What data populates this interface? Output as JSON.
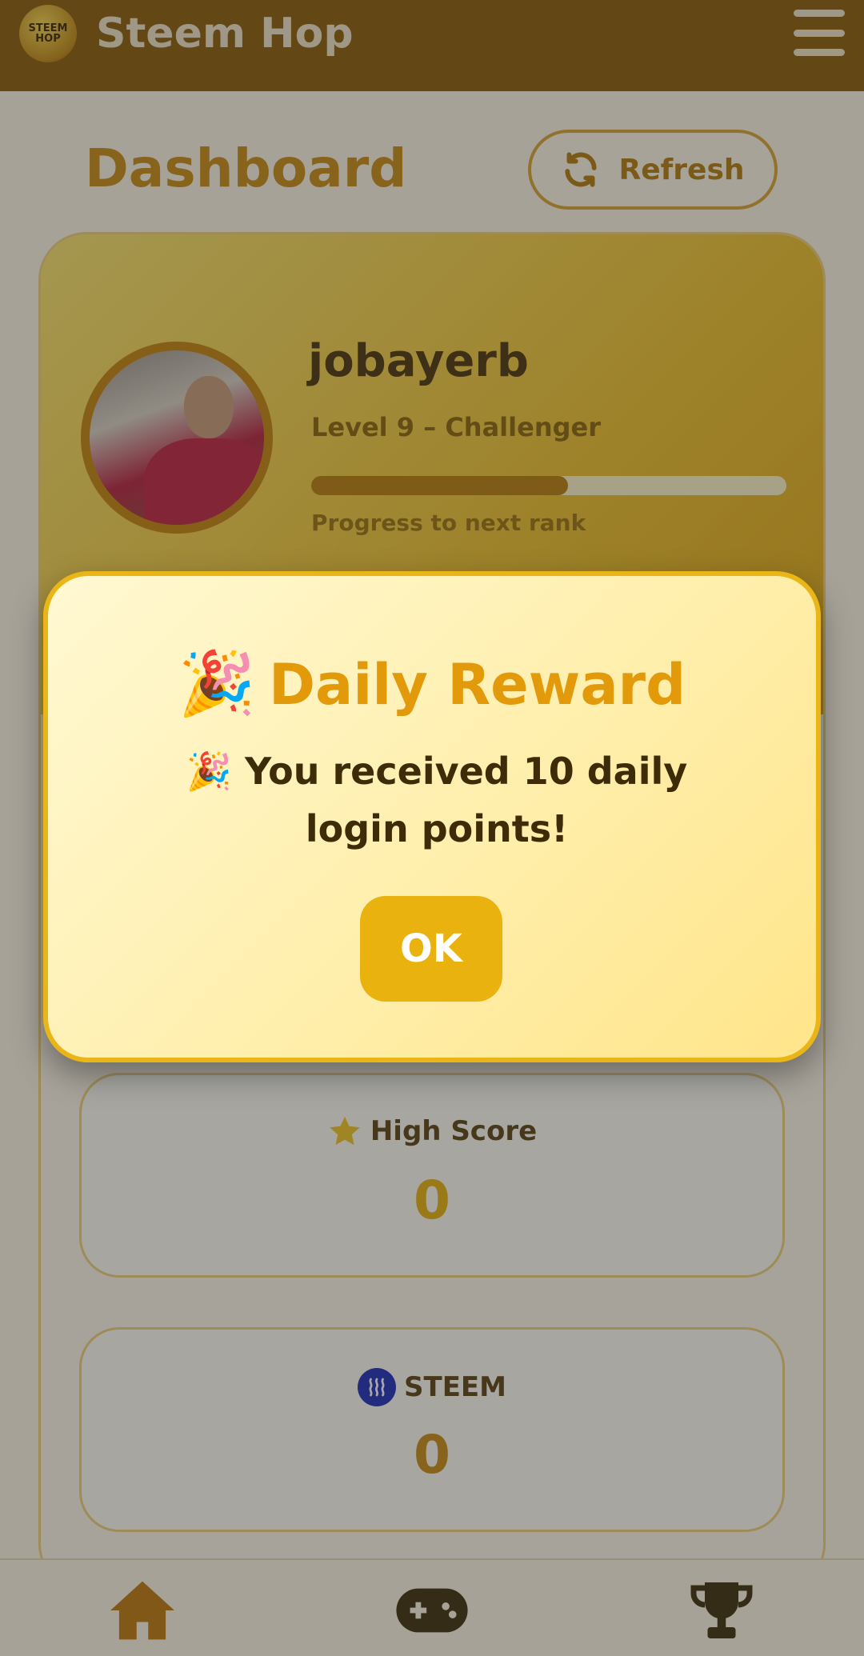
{
  "header": {
    "app_title": "Steem Hop",
    "logo_text": "STEEM HOP"
  },
  "dashboard": {
    "title": "Dashboard",
    "refresh_label": "Refresh"
  },
  "profile": {
    "username": "jobayerb",
    "level": "Level 9 – Challenger",
    "progress_fraction": 0.54,
    "progress_label": "Progress to next rank"
  },
  "stats": {
    "high_score": {
      "label": "High Score",
      "value": "0",
      "icon": "star-icon"
    },
    "steem": {
      "label": "STEEM",
      "value": "0",
      "icon": "steem-icon"
    }
  },
  "modal": {
    "title": "Daily Reward",
    "title_emoji": "🎉",
    "message_emoji": "🎉",
    "message": "You received 10 daily login points!",
    "ok_label": "OK"
  },
  "bottom_nav": [
    {
      "name": "home",
      "icon": "home-icon"
    },
    {
      "name": "games",
      "icon": "gamepad-icon"
    },
    {
      "name": "leaderboard",
      "icon": "trophy-icon"
    }
  ],
  "colors": {
    "header": "#8a5a05",
    "accent": "#e29a0a",
    "button": "#eab20e",
    "steem_blue": "#1a2ab8"
  }
}
